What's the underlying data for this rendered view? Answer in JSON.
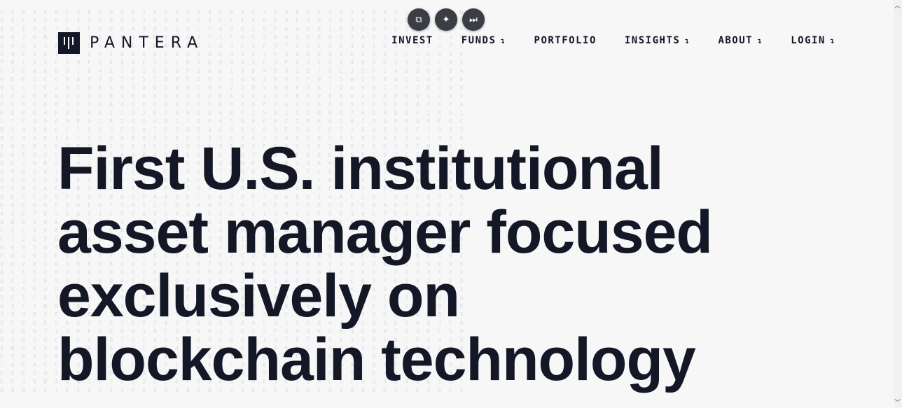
{
  "brand": {
    "name": "PANTERA"
  },
  "nav": [
    {
      "label": "INVEST",
      "arrow": ""
    },
    {
      "label": "FUNDS",
      "arrow": "↴"
    },
    {
      "label": "PORTFOLIO",
      "arrow": ""
    },
    {
      "label": "INSIGHTS",
      "arrow": "↴"
    },
    {
      "label": "ABOUT",
      "arrow": "↴"
    },
    {
      "label": "LOGIN",
      "arrow": "↴"
    }
  ],
  "floating_controls": [
    "copy-icon",
    "sparkle-icon",
    "skip-forward-icon"
  ],
  "hero": {
    "headline": "First U.S. institutional asset manager focused exclusively on blockchain technology"
  },
  "colors": {
    "text": "#141726",
    "background": "#f7f7f8",
    "pattern": "#dcdde2"
  }
}
